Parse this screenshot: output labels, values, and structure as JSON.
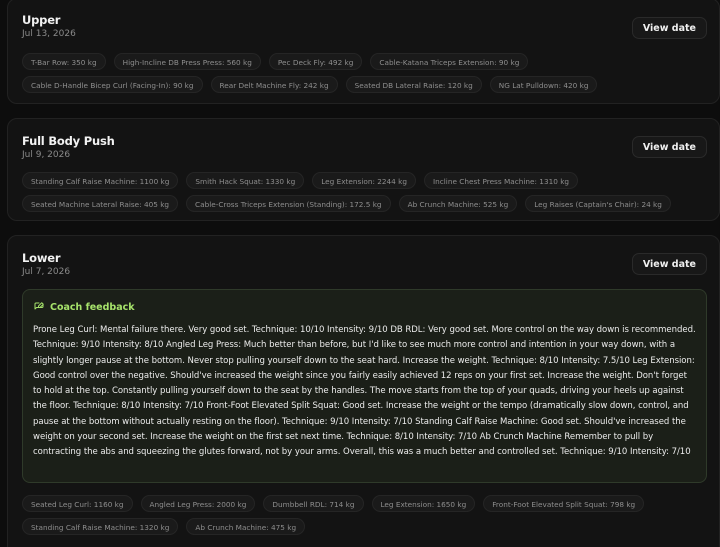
{
  "workouts": [
    {
      "title": "Upper",
      "date": "Jul 13, 2026",
      "view_label": "View date",
      "exercises": [
        "T-Bar Row: 350 kg",
        "High-Incline DB Press Press: 560 kg",
        "Pec Deck Fly: 492 kg",
        "Cable-Katana Triceps Extension: 90 kg",
        "Cable D-Handle Bicep Curl (Facing-In): 90 kg",
        "Rear Delt Machine Fly: 242 kg",
        "Seated DB Lateral Raise: 120 kg",
        "NG Lat Pulldown: 420 kg"
      ]
    },
    {
      "title": "Full Body Push",
      "date": "Jul 9, 2026",
      "view_label": "View date",
      "exercises": [
        "Standing Calf Raise Machine: 1100 kg",
        "Smith Hack Squat: 1330 kg",
        "Leg Extension: 2244 kg",
        "Incline Chest Press Machine: 1310 kg",
        "Seated Machine Lateral Raise: 405 kg",
        "Cable-Cross Triceps Extension (Standing): 172.5 kg",
        "Ab Crunch Machine: 525 kg",
        "Leg Raises (Captain's Chair): 24 kg"
      ]
    },
    {
      "title": "Lower",
      "date": "Jul 7, 2026",
      "view_label": "View date",
      "feedback_title": "Coach feedback",
      "feedback_icon": "message-edit-icon",
      "feedback_text": "Prone Leg Curl: Mental failure there. Very good set. Technique: 10/10 Intensity: 9/10 DB RDL: Very good set. More control on the way down is recommended. Technique: 9/10 Intensity: 8/10 Angled Leg Press: Much better than before, but I'd like to see much more control and intention in your way down, with a slightly longer pause at the bottom. Never stop pulling yourself down to the seat hard. Increase the weight. Technique: 8/10 Intensity: 7.5/10 Leg Extension: Good control over the negative. Should've increased the weight since you fairly easily achieved 12 reps on your first set. Increase the weight. Don't forget to hold at the top. Constantly pulling yourself down to the seat by the handles. The move starts from the top of your quads, driving your heels up against the floor. Technique: 8/10 Intensity: 7/10 Front-Foot Elevated Split Squat: Good set. Increase the weight or the tempo (dramatically slow down, control, and pause at the bottom without actually resting on the floor). Technique: 9/10 Intensity: 7/10 Standing Calf Raise Machine: Good set. Should've increased the weight on your second set. Increase the weight on the first set next time. Technique: 8/10 Intensity: 7/10 Ab Crunch Machine Remember to pull by contracting the abs and squeezing the glutes forward, not by your arms. Overall, this was a much better and controlled set. Technique: 9/10 Intensity: 7/10",
      "exercises": [
        "Seated Leg Curl: 1160 kg",
        "Angled Leg Press: 2000 kg",
        "Dumbbell RDL: 714 kg",
        "Leg Extension: 1650 kg",
        "Front-Foot Elevated Split Squat: 798 kg",
        "Standing Calf Raise Machine: 1320 kg",
        "Ab Crunch Machine: 475 kg"
      ]
    }
  ],
  "colors": {
    "background": "#0d0d0d",
    "card": "#131313",
    "accent": "#a7e36b",
    "feedback_bg": "#1b1f18"
  }
}
